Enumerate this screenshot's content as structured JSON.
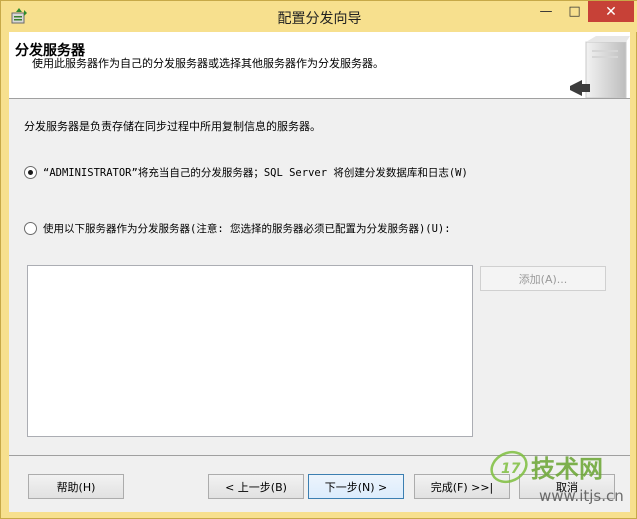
{
  "window": {
    "title": "配置分发向导",
    "controls": {
      "minimize": "—",
      "maximize": "□",
      "close": "✕"
    }
  },
  "header": {
    "title": "分发服务器",
    "subtitle": "使用此服务器作为自己的分发服务器或选择其他服务器作为分发服务器。"
  },
  "body": {
    "description": "分发服务器是负责存储在同步过程中所用复制信息的服务器。",
    "options": [
      {
        "label": "“ADMINISTRATOR”将充当自己的分发服务器；SQL Server 将创建分发数据库和日志(W)",
        "checked": true
      },
      {
        "label": "使用以下服务器作为分发服务器(注意: 您选择的服务器必须已配置为分发服务器)(U):",
        "checked": false
      }
    ],
    "add_button": "添加(A)..."
  },
  "footer": {
    "help": "帮助(H)",
    "prev": "< 上一步(B)",
    "next": "下一步(N) >",
    "finish": "完成(F) >>|",
    "cancel": "取消"
  },
  "watermark": {
    "brand": "17技术网",
    "url": "www.itjs.cn"
  },
  "colors": {
    "titlebar": "#f7e08e",
    "close_button": "#c74137",
    "dialog_bg": "#f0f0f0",
    "header_bg": "#ffffff",
    "watermark_green": "#7fbf3f"
  }
}
